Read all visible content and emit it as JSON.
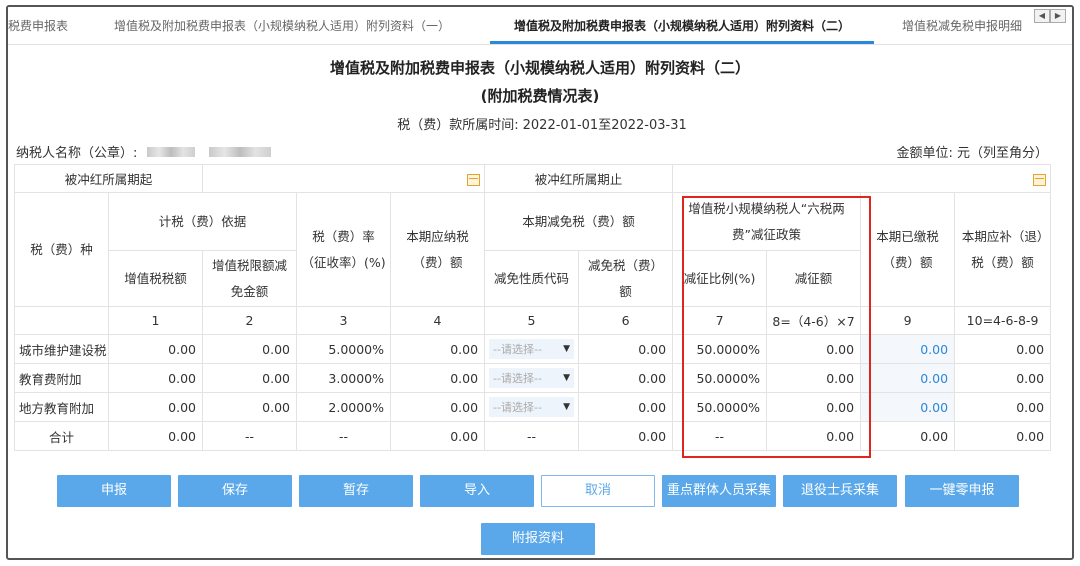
{
  "tabs": [
    {
      "label": "税费申报表",
      "active": false
    },
    {
      "label": "增值税及附加税费申报表（小规模纳税人适用）附列资料（一）",
      "active": false
    },
    {
      "label": "增值税及附加税费申报表（小规模纳税人适用）附列资料（二）",
      "active": true
    },
    {
      "label": "增值税减免税申报明细",
      "active": false
    }
  ],
  "header": {
    "title": "增值税及附加税费申报表（小规模纳税人适用）附列资料（二）",
    "subtitle": "(附加税费情况表)",
    "period_label": "税（费）款所属时间:",
    "period_value": "2022-01-01至2022-03-31",
    "payer_label": "纳税人名称（公章）:",
    "unit_label": "金额单位: 元（列至角分）"
  },
  "offset": {
    "start_label": "被冲红所属期起",
    "end_label": "被冲红所属期止"
  },
  "columns": {
    "tax_type": "税（费）种",
    "basis": "计税（费）依据",
    "vat_amount": "增值税税额",
    "vat_limit_exempt": "增值税限额减免金额",
    "rate": "税（费）率（征收率）(%)",
    "payable": "本期应纳税（费）额",
    "exempt_group": "本期减免税（费）额",
    "exempt_code": "减免性质代码",
    "exempt_amount": "减免税（费）额",
    "policy_group": "增值税小规模纳税人“六税两费”减征政策",
    "reduce_ratio": "减征比例(%)",
    "reduce_amount": "减征额",
    "paid": "本期已缴税（费）额",
    "refund": "本期应补（退）税（费）额"
  },
  "col_numbers": [
    "1",
    "2",
    "3",
    "4",
    "5",
    "6",
    "7",
    "8=（4-6）×7",
    "9",
    "10=4-6-8-9"
  ],
  "rows": [
    {
      "name": "城市维护建设税",
      "vat": "0.00",
      "limit": "0.00",
      "rate": "5.0000%",
      "payable": "0.00",
      "code": "--请选择--",
      "exempt": "0.00",
      "ratio": "50.0000%",
      "reduce": "0.00",
      "paid": "0.00",
      "refund": "0.00"
    },
    {
      "name": "教育费附加",
      "vat": "0.00",
      "limit": "0.00",
      "rate": "3.0000%",
      "payable": "0.00",
      "code": "--请选择--",
      "exempt": "0.00",
      "ratio": "50.0000%",
      "reduce": "0.00",
      "paid": "0.00",
      "refund": "0.00"
    },
    {
      "name": "地方教育附加",
      "vat": "0.00",
      "limit": "0.00",
      "rate": "2.0000%",
      "payable": "0.00",
      "code": "--请选择--",
      "exempt": "0.00",
      "ratio": "50.0000%",
      "reduce": "0.00",
      "paid": "0.00",
      "refund": "0.00"
    }
  ],
  "total": {
    "name": "合计",
    "vat": "0.00",
    "limit": "--",
    "rate": "--",
    "payable": "0.00",
    "code": "--",
    "exempt": "0.00",
    "ratio": "--",
    "reduce": "0.00",
    "paid": "0.00",
    "refund": "0.00"
  },
  "buttons": {
    "declare": "申报",
    "save": "保存",
    "stash": "暂存",
    "import": "导入",
    "cancel": "取消",
    "key_group": "重点群体人员采集",
    "veteran": "退役士兵采集",
    "zero_declare": "一键零申报",
    "attach": "附报资料"
  },
  "colors": {
    "accent": "#2b87d9",
    "button": "#5aa8ea",
    "highlight": "#e0251d",
    "calendar": "#e3a32f"
  }
}
